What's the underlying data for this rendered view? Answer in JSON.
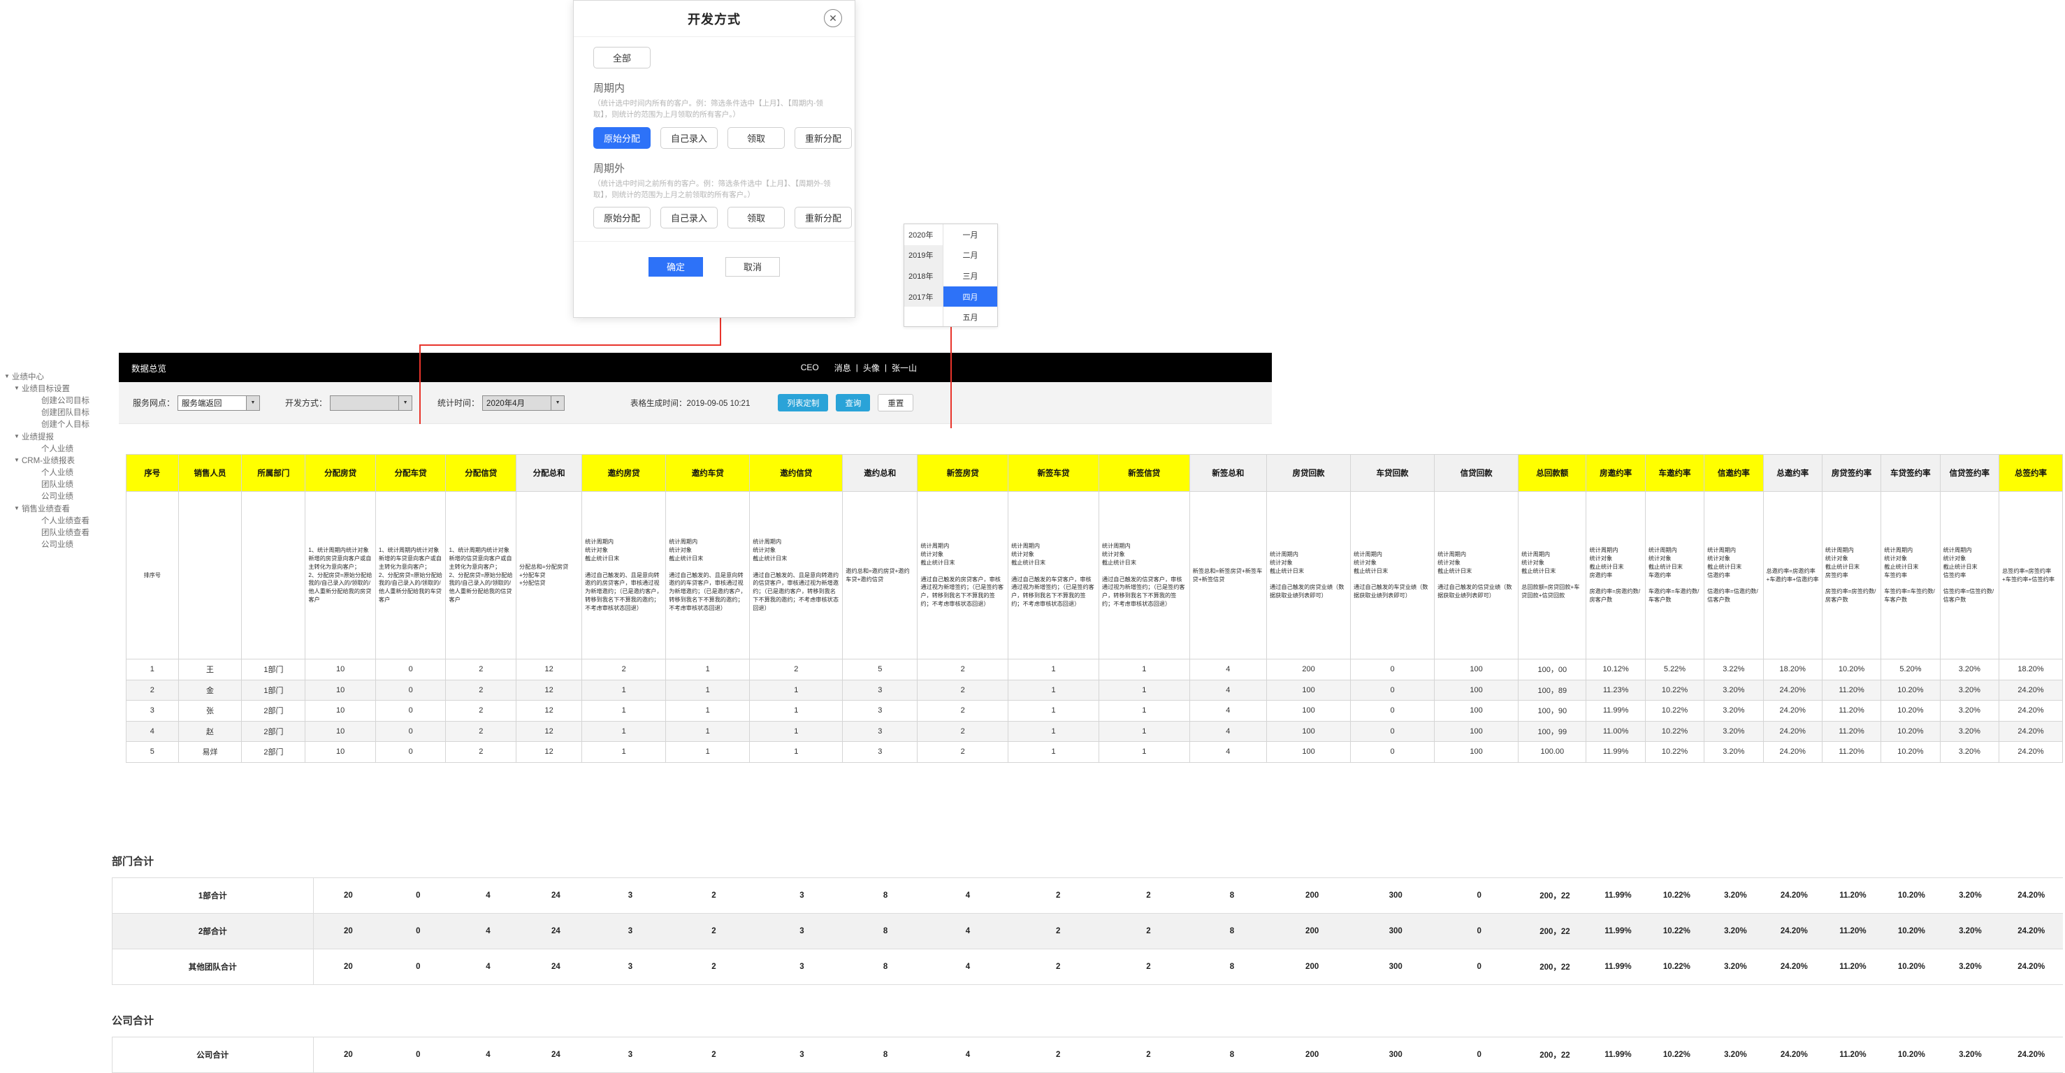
{
  "dialog": {
    "title": "开发方式",
    "close_icon": "close-icon",
    "all_button": "全部",
    "in_period": {
      "title": "周期内",
      "desc": "（统计选中时间内所有的客户。例：筛选条件选中【上月】、【周期内-领取】，则统计的范围为上月领取的所有客户。）",
      "options": [
        "原始分配",
        "自己录入",
        "领取",
        "重新分配"
      ],
      "selected": "原始分配"
    },
    "out_period": {
      "title": "周期外",
      "desc": "（统计选中时间之前所有的客户。例：筛选条件选中【上月】、【周期外-领取】，则统计的范围为上月之前领取的所有客户。）",
      "options": [
        "原始分配",
        "自己录入",
        "领取",
        "重新分配"
      ],
      "selected": ""
    },
    "confirm": "确定",
    "cancel": "取消"
  },
  "datepicker": {
    "years": [
      "2020年",
      "2019年",
      "2018年",
      "2017年"
    ],
    "months": [
      "一月",
      "二月",
      "三月",
      "四月",
      "五月"
    ],
    "selected_month": "四月"
  },
  "sidebar": {
    "items": [
      {
        "label": "业绩中心",
        "level": 0,
        "caret": "▼"
      },
      {
        "label": "业绩目标设置",
        "level": 1,
        "caret": "▼"
      },
      {
        "label": "创建公司目标",
        "level": 2,
        "caret": ""
      },
      {
        "label": "创建团队目标",
        "level": 2,
        "caret": ""
      },
      {
        "label": "创建个人目标",
        "level": 2,
        "caret": ""
      },
      {
        "label": "业绩提报",
        "level": 1,
        "caret": "▼"
      },
      {
        "label": "个人业绩",
        "level": 2,
        "caret": ""
      },
      {
        "label": "CRM-业绩报表",
        "level": 1,
        "caret": "▼"
      },
      {
        "label": "个人业绩",
        "level": 2,
        "caret": ""
      },
      {
        "label": "团队业绩",
        "level": 2,
        "caret": ""
      },
      {
        "label": "公司业绩",
        "level": 2,
        "caret": ""
      },
      {
        "label": "销售业绩查看",
        "level": 1,
        "caret": "▼"
      },
      {
        "label": "个人业绩查看",
        "level": 2,
        "caret": ""
      },
      {
        "label": "团队业绩查看",
        "level": 2,
        "caret": ""
      },
      {
        "label": "公司业绩",
        "level": 2,
        "caret": ""
      }
    ]
  },
  "topbar": {
    "title": "数据总览",
    "role": "CEO",
    "message": "消息",
    "avatar_label": "头像",
    "user": "张一山",
    "sep": "|"
  },
  "filterbar": {
    "outlet_label": "服务网点：",
    "outlet_value": "服务端返回",
    "devmode_label": "开发方式：",
    "devmode_value": "",
    "stattime_label": "统计时间：",
    "stattime_value": "2020年4月",
    "gen_time": "表格生成时间：2019-09-05 10:21",
    "list_custom": "列表定制",
    "query": "查询",
    "reset": "重置"
  },
  "table": {
    "columns": [
      {
        "name": "序号",
        "hl": true,
        "w": 46,
        "desc": "排序号",
        "center": true
      },
      {
        "name": "销售人员",
        "hl": true,
        "w": 56,
        "desc": ""
      },
      {
        "name": "所属部门",
        "hl": true,
        "w": 56,
        "desc": ""
      },
      {
        "name": "分配房贷",
        "hl": true,
        "w": 62,
        "desc": "1、统计周期内统计对象\n新增的房贷意向客户或自主转化为意向客户；\n2、分配房贷=原始分配给我的/自己录入的/领取的/他人重新分配给我的房贷客户"
      },
      {
        "name": "分配车贷",
        "hl": true,
        "w": 62,
        "desc": "1、统计周期内统计对象\n新增的车贷意向客户或自主转化为意向客户；\n2、分配房贷=原始分配给我的/自己录入的/领取的/他人重新分配给我的车贷客户"
      },
      {
        "name": "分配信贷",
        "hl": true,
        "w": 62,
        "desc": "1、统计周期内统计对象\n新增的信贷意向客户或自主转化为意向客户；\n2、分配房贷=原始分配给我的/自己录入的/领取的/他人重新分配给我的信贷客户"
      },
      {
        "name": "分配总和",
        "hl": false,
        "w": 58,
        "desc": "分配总和=分配房贷\n+分配车贷\n+分配信贷"
      },
      {
        "name": "邀约房贷",
        "hl": true,
        "w": 74,
        "desc": "统计周期内\n统计对象\n截止统计日末\n\n通过自己触发的、且是意向转邀约的房贷客户，审核通过视为新增邀约；（已是邀约客户，转移到我名下不算我的邀约；不考虑审核状态回退）"
      },
      {
        "name": "邀约车贷",
        "hl": true,
        "w": 74,
        "desc": "统计周期内\n统计对象\n截止统计日末\n\n通过自己触发的、且是意向转邀约的车贷客户，审核通过视为新增邀约；（已是邀约客户，转移到我名下不算我的邀约；不考虑审核状态回退）"
      },
      {
        "name": "邀约信贷",
        "hl": true,
        "w": 82,
        "desc": "统计周期内\n统计对象\n截止统计日末\n\n通过自己触发的、且是意向转邀约的信贷客户，审核通过视为新增邀约；（已是邀约客户，转移到我名下不算我的邀约；不考虑审核状态回退）"
      },
      {
        "name": "邀约总和",
        "hl": false,
        "w": 66,
        "desc": "邀约总和=邀约房贷+邀约车贷+邀约信贷"
      },
      {
        "name": "新签房贷",
        "hl": true,
        "w": 80,
        "desc": "统计周期内\n统计对象\n截止统计日末\n\n通过自己触发的房贷客户，审核通过视为新增签约；（已是签约客户，转移到我名下不算我的签约；不考虑审核状态回退）"
      },
      {
        "name": "新签车贷",
        "hl": true,
        "w": 80,
        "desc": "统计周期内\n统计对象\n截止统计日末\n\n通过自己触发的车贷客户，审核通过视为新增签约；（已是签约客户，转移到我名下不算我的签约；不考虑审核状态回退）"
      },
      {
        "name": "新签信贷",
        "hl": true,
        "w": 80,
        "desc": "统计周期内\n统计对象\n截止统计日末\n\n通过自己触发的信贷客户，审核通过视为新增签约；（已是签约客户，转移到我名下不算我的签约；不考虑审核状态回退）"
      },
      {
        "name": "新签总和",
        "hl": false,
        "w": 68,
        "desc": "新签总和=新签房贷+新签车贷+新签信贷"
      },
      {
        "name": "房贷回款",
        "hl": false,
        "w": 74,
        "desc": "统计周期内\n统计对象\n截止统计日末\n\n通过自己触发的房贷业绩（数据获取业绩列表即可）"
      },
      {
        "name": "车贷回款",
        "hl": false,
        "w": 74,
        "desc": "统计周期内\n统计对象\n截止统计日末\n\n通过自己触发的车贷业绩（数据获取业绩列表即可）"
      },
      {
        "name": "信贷回款",
        "hl": false,
        "w": 74,
        "desc": "统计周期内\n统计对象\n截止统计日末\n\n通过自己触发的信贷业绩（数据获取业绩列表即可）"
      },
      {
        "name": "总回款额",
        "hl": true,
        "w": 60,
        "desc": "统计周期内\n统计对象\n截止统计日末\n\n总回款额=房贷回款+车贷回款+信贷回款"
      },
      {
        "name": "房邀约率",
        "hl": true,
        "w": 52,
        "desc": "统计周期内\n统计对象\n截止统计日末\n房邀约率\n\n房邀约率=房邀约数/房客户数"
      },
      {
        "name": "车邀约率",
        "hl": true,
        "w": 52,
        "desc": "统计周期内\n统计对象\n截止统计日末\n车邀约率\n\n车邀约率=车邀约数/车客户数"
      },
      {
        "name": "信邀约率",
        "hl": true,
        "w": 52,
        "desc": "统计周期内\n统计对象\n截止统计日末\n信邀约率\n\n信邀约率=信邀约数/信客户数"
      },
      {
        "name": "总邀约率",
        "hl": false,
        "w": 52,
        "desc": "总邀约率=房邀约率+车邀约率+信邀约率"
      },
      {
        "name": "房贷签约率",
        "hl": false,
        "w": 52,
        "desc": "统计周期内\n统计对象\n截止统计日末\n房签约率\n\n房签约率=房签约数/房客户数"
      },
      {
        "name": "车贷签约率",
        "hl": false,
        "w": 52,
        "desc": "统计周期内\n统计对象\n截止统计日末\n车签约率\n\n车签约率=车签约数/车客户数"
      },
      {
        "name": "信贷签约率",
        "hl": false,
        "w": 52,
        "desc": "统计周期内\n统计对象\n截止统计日末\n信签约率\n\n信签约率=信签约数/信客户数"
      },
      {
        "name": "总签约率",
        "hl": true,
        "w": 56,
        "desc": "总签约率=房签约率+车签约率+信签约率"
      }
    ],
    "rows": [
      [
        "1",
        "王",
        "1部门",
        "10",
        "0",
        "2",
        "12",
        "2",
        "1",
        "2",
        "5",
        "2",
        "1",
        "1",
        "4",
        "200",
        "0",
        "100",
        "100，00",
        "10.12%",
        "5.22%",
        "3.22%",
        "18.20%",
        "10.20%",
        "5.20%",
        "3.20%",
        "18.20%"
      ],
      [
        "2",
        "金",
        "1部门",
        "10",
        "0",
        "2",
        "12",
        "1",
        "1",
        "1",
        "3",
        "2",
        "1",
        "1",
        "4",
        "100",
        "0",
        "100",
        "100，89",
        "11.23%",
        "10.22%",
        "3.20%",
        "24.20%",
        "11.20%",
        "10.20%",
        "3.20%",
        "24.20%"
      ],
      [
        "3",
        "张",
        "2部门",
        "10",
        "0",
        "2",
        "12",
        "1",
        "1",
        "1",
        "3",
        "2",
        "1",
        "1",
        "4",
        "100",
        "0",
        "100",
        "100，90",
        "11.99%",
        "10.22%",
        "3.20%",
        "24.20%",
        "11.20%",
        "10.20%",
        "3.20%",
        "24.20%"
      ],
      [
        "4",
        "赵",
        "2部门",
        "10",
        "0",
        "2",
        "12",
        "1",
        "1",
        "1",
        "3",
        "2",
        "1",
        "1",
        "4",
        "100",
        "0",
        "100",
        "100，99",
        "11.00%",
        "10.22%",
        "3.20%",
        "24.20%",
        "11.20%",
        "10.20%",
        "3.20%",
        "24.20%"
      ],
      [
        "5",
        "易烊",
        "2部门",
        "10",
        "0",
        "2",
        "12",
        "1",
        "1",
        "1",
        "3",
        "2",
        "1",
        "1",
        "4",
        "100",
        "0",
        "100",
        "100.00",
        "11.99%",
        "10.22%",
        "3.20%",
        "24.20%",
        "11.20%",
        "10.20%",
        "3.20%",
        "24.20%"
      ]
    ]
  },
  "dept_summary": {
    "title": "部门合计",
    "rows": [
      [
        "1部合计",
        "20",
        "0",
        "4",
        "24",
        "3",
        "2",
        "3",
        "8",
        "4",
        "2",
        "2",
        "8",
        "200",
        "300",
        "0",
        "200，22",
        "11.99%",
        "10.22%",
        "3.20%",
        "24.20%",
        "11.20%",
        "10.20%",
        "3.20%",
        "24.20%"
      ],
      [
        "2部合计",
        "20",
        "0",
        "4",
        "24",
        "3",
        "2",
        "3",
        "8",
        "4",
        "2",
        "2",
        "8",
        "200",
        "300",
        "0",
        "200，22",
        "11.99%",
        "10.22%",
        "3.20%",
        "24.20%",
        "11.20%",
        "10.20%",
        "3.20%",
        "24.20%"
      ],
      [
        "其他团队合计",
        "20",
        "0",
        "4",
        "24",
        "3",
        "2",
        "3",
        "8",
        "4",
        "2",
        "2",
        "8",
        "200",
        "300",
        "0",
        "200，22",
        "11.99%",
        "10.22%",
        "3.20%",
        "24.20%",
        "11.20%",
        "10.20%",
        "3.20%",
        "24.20%"
      ]
    ]
  },
  "company_summary": {
    "title": "公司合计",
    "rows": [
      [
        "公司合计",
        "20",
        "0",
        "4",
        "24",
        "3",
        "2",
        "3",
        "8",
        "4",
        "2",
        "2",
        "8",
        "200",
        "300",
        "0",
        "200，22",
        "11.99%",
        "10.22%",
        "3.20%",
        "24.20%",
        "11.20%",
        "10.20%",
        "3.20%",
        "24.20%"
      ]
    ]
  },
  "colors": {
    "highlight": "#ffff00",
    "accent_blue": "#2d72f8",
    "button_blue": "#2aa3d8",
    "connector_red": "#e8342b"
  }
}
